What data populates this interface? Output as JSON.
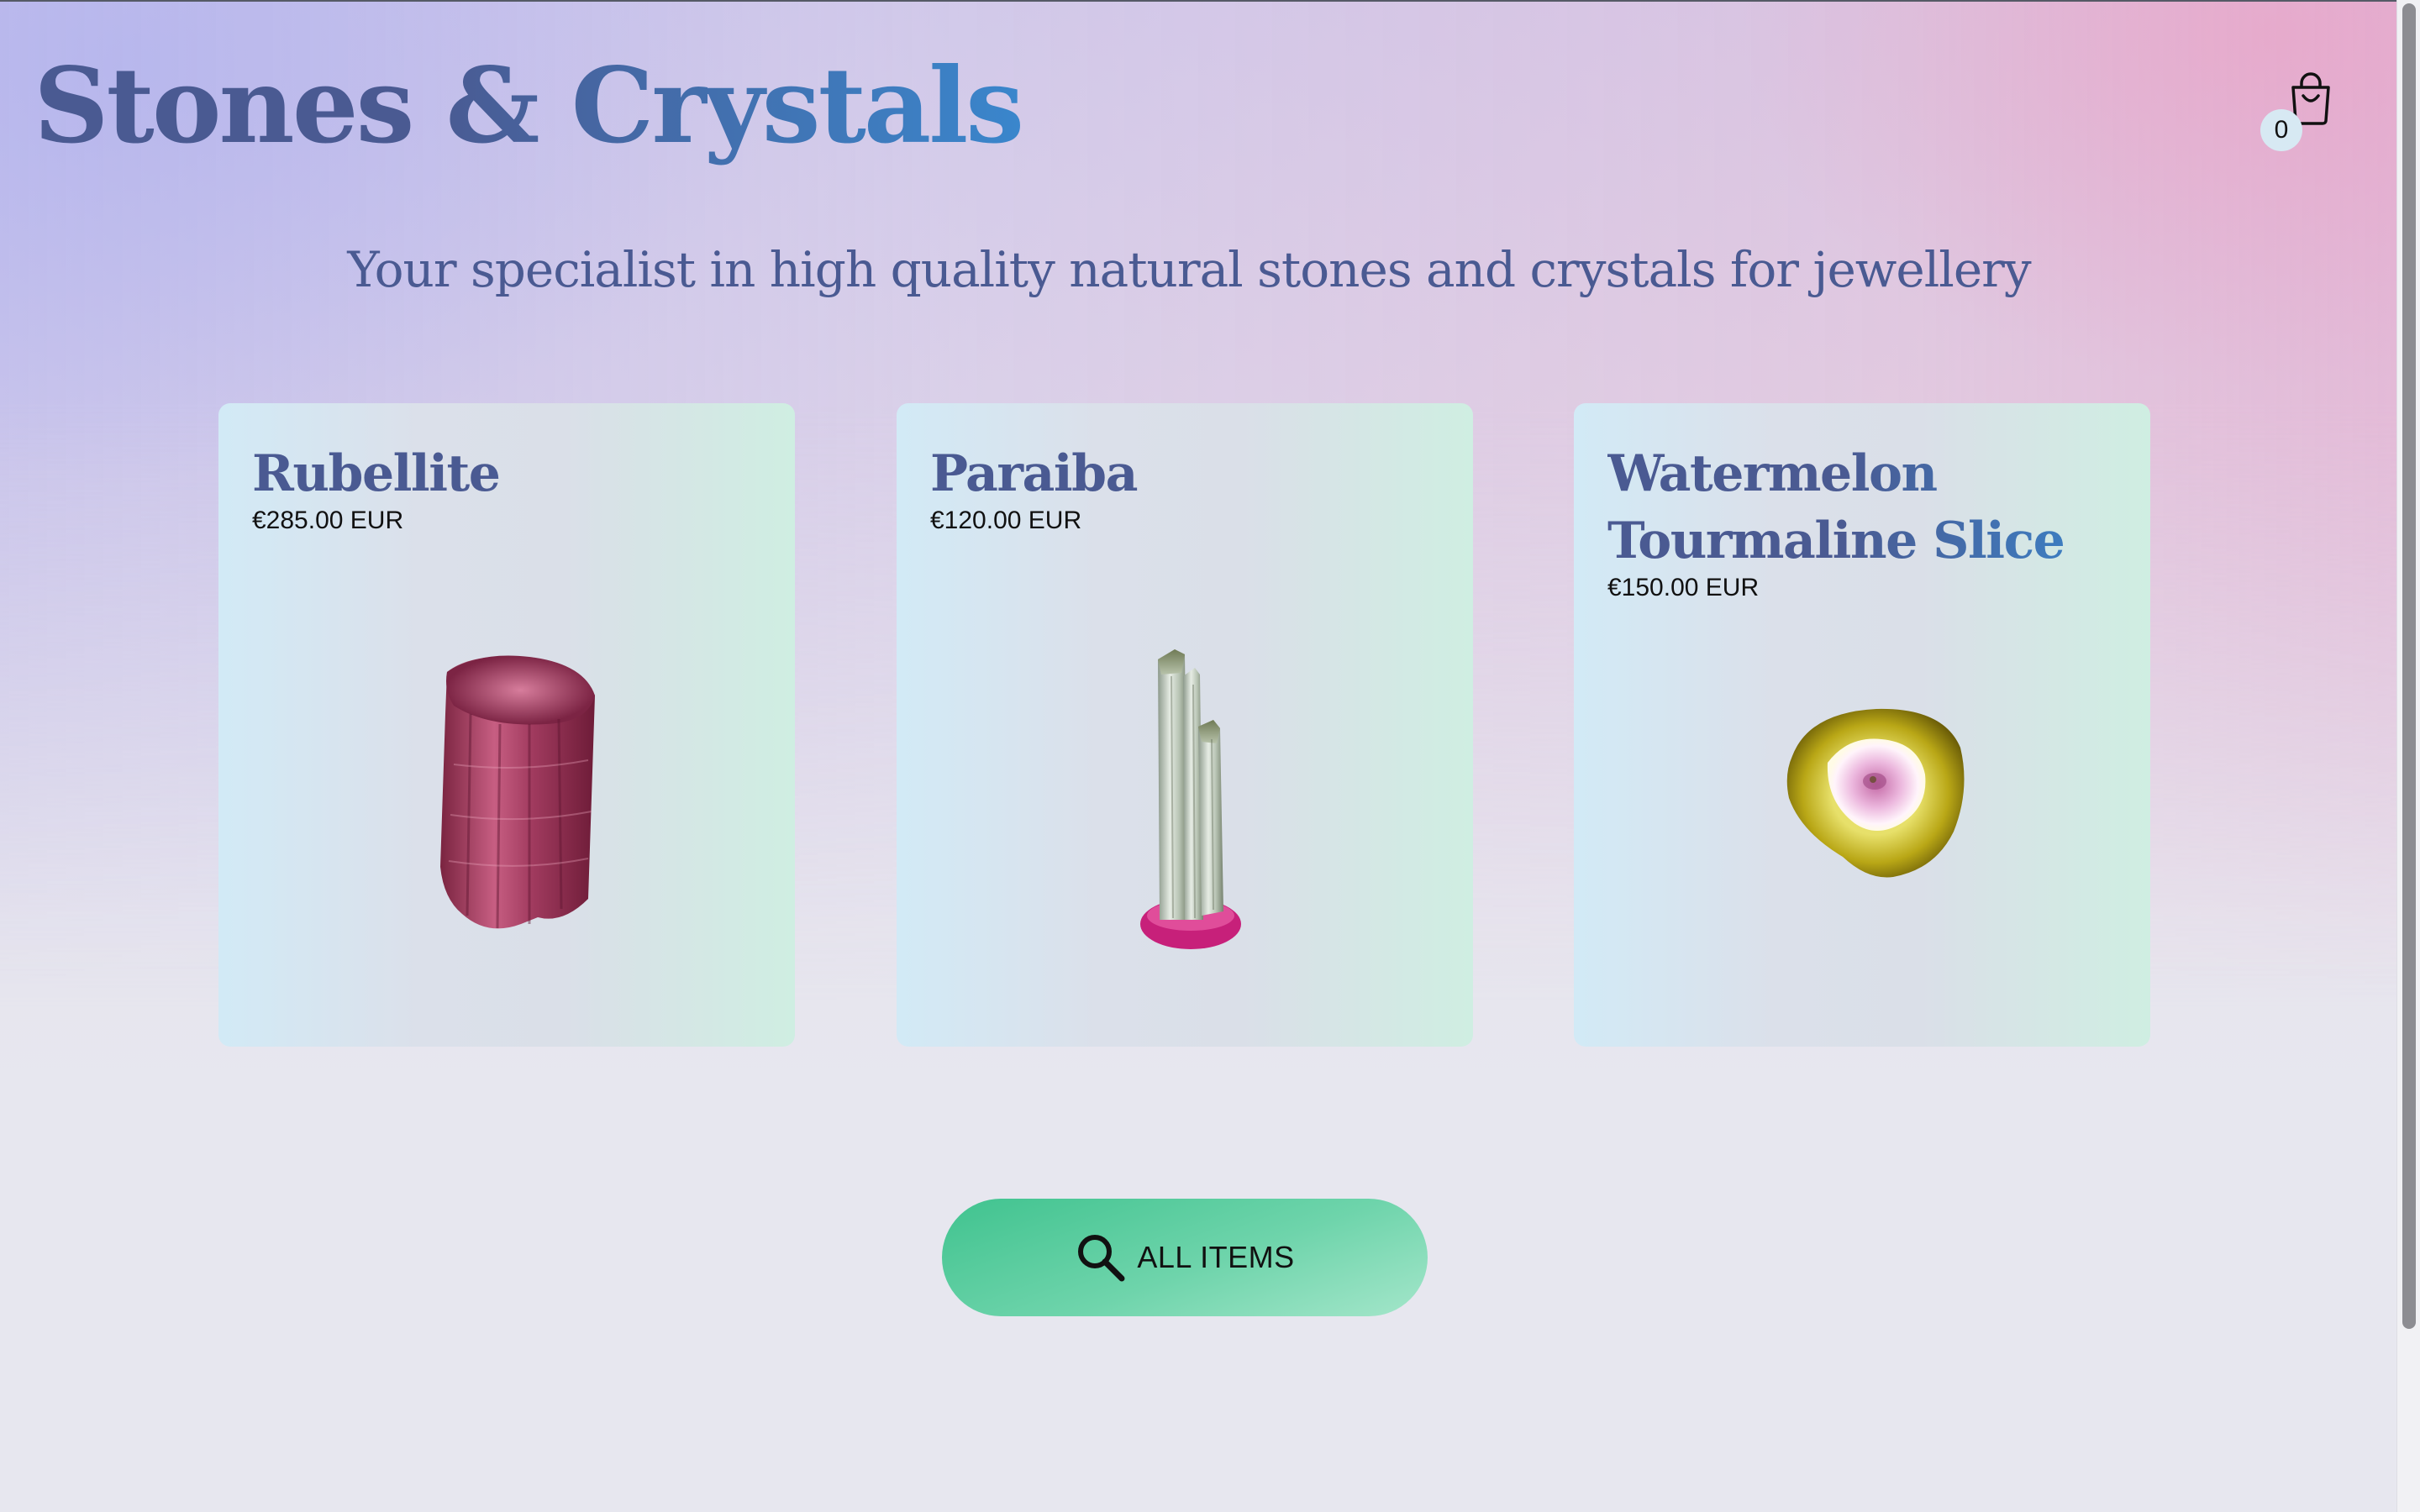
{
  "header": {
    "title": "Stones & Crystals",
    "cart_count": "0"
  },
  "tagline": "Your specialist in high quality natural stones and crystals for jewellery",
  "products": [
    {
      "name": "Rubellite",
      "price": "€285.00 EUR",
      "icon": "rubellite-crystal"
    },
    {
      "name": "Paraiba",
      "price": "€120.00 EUR",
      "icon": "paraiba-crystal"
    },
    {
      "name": "Watermelon Tourmaline Slice",
      "price": "€150.00 EUR",
      "icon": "watermelon-tourmaline-slice"
    }
  ],
  "all_items_button": {
    "label": "ALL ITEMS",
    "icon": "search-icon"
  },
  "colors": {
    "title_start": "#4a5a92",
    "title_end": "#3a86cc",
    "button_green": "#40c38f",
    "cart_badge": "#d7e9f3"
  }
}
